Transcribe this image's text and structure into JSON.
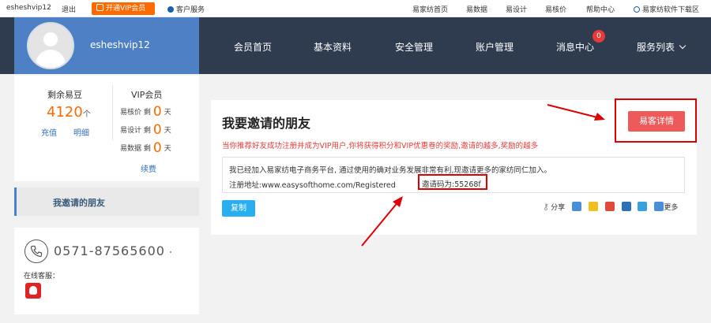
{
  "topbar": {
    "username": "esheshvip12",
    "logout": "退出",
    "open_vip": "开通VIP会员",
    "customer_service": "客户服务",
    "links": [
      "易家纺首页",
      "易数据",
      "易设计",
      "易核价",
      "帮助中心"
    ],
    "download": "易家纺软件下载区"
  },
  "header": {
    "username": "esheshvip12",
    "nav": [
      "会员首页",
      "基本资料",
      "安全管理",
      "账户管理",
      "消息中心",
      "服务列表"
    ],
    "message_count": "0"
  },
  "sidebar": {
    "beans_title": "剩余易豆",
    "beans_value": "4120",
    "beans_unit": "个",
    "recharge": "充值",
    "detail": "明细",
    "vip_title": "VIP会员",
    "vip_rows": [
      {
        "label": "易核价 剩",
        "value": "0",
        "unit": "天"
      },
      {
        "label": "易设计 剩",
        "value": "0",
        "unit": "天"
      },
      {
        "label": "易数据 剩",
        "value": "0",
        "unit": "天"
      }
    ],
    "renew": "续费",
    "menu_selected": "我邀请的朋友"
  },
  "contact": {
    "phone": "0571-87565600",
    "online_label": "在线客服："
  },
  "main": {
    "title": "我要邀请的朋友",
    "note": "当你推荐好友成功注册并成为VIP用户,你将获得积分和VIP优惠卷的奖励,邀请的越多,奖励的越多",
    "invite_text": "我已经加入易家纺电子商务平台, 通过使用的确对业务发展非常有利,现邀请更多的家纺同仁加入。",
    "register_url": "注册地址:www.easysofthome.com/Registered",
    "invite_code": "邀请码为:55268f",
    "copy_button": "复制",
    "share_label": "分享",
    "more_label": "更多",
    "detail_button": "易客详情"
  },
  "colors": {
    "accent_orange": "#ff6a00",
    "header_dark": "#2f3b4f",
    "user_blue": "#4e80c5",
    "highlight_red": "#e00000",
    "copy_blue": "#29aef0"
  }
}
